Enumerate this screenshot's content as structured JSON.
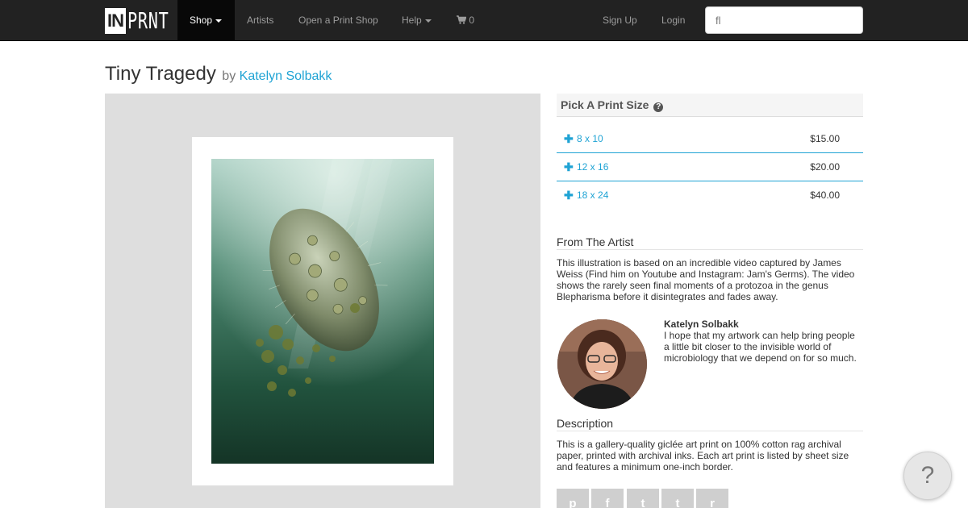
{
  "navbar": {
    "logo_in": "IN",
    "logo_prnt": "PRNT",
    "shop": "Shop",
    "artists": "Artists",
    "open_shop": "Open a Print Shop",
    "help": "Help",
    "cart_count": "0",
    "sign_up": "Sign Up",
    "login": "Login",
    "search_placeholder": "fl"
  },
  "page": {
    "title": "Tiny Tragedy",
    "by": "by",
    "artist": "Katelyn Solbakk"
  },
  "print_sizes": {
    "header": "Pick A Print Size",
    "help_glyph": "?",
    "items": [
      {
        "label": "8 x 10",
        "price": "$15.00"
      },
      {
        "label": "12 x 16",
        "price": "$20.00"
      },
      {
        "label": "18 x 24",
        "price": "$40.00"
      }
    ]
  },
  "from_artist": {
    "title": "From The Artist",
    "text": "This illustration is based on an incredible video captured by James Weiss (Find him on Youtube and Instagram: Jam's Germs). The video shows the rarely seen final moments of a protozoa in the genus Blepharisma before it disintegrates and fades away.",
    "name": "Katelyn Solbakk",
    "quote": "I hope that my artwork can help bring people a little bit closer to the invisible world of microbiology that we depend on for so much."
  },
  "description": {
    "title": "Description",
    "text": "This is a gallery-quality giclée art print on 100% cotton rag archival paper, printed with archival inks. Each art print is listed by sheet size and features a minimum one-inch border."
  },
  "share": {
    "pinterest_glyph": "p",
    "facebook_glyph": "f",
    "twitter_glyph": "t",
    "tumblr_glyph": "t",
    "reddit_glyph": "r"
  },
  "help_fab": "?",
  "colors": {
    "nav_bg": "#222222",
    "accent": "#1fa3d4",
    "panel_bg": "#dedede"
  }
}
